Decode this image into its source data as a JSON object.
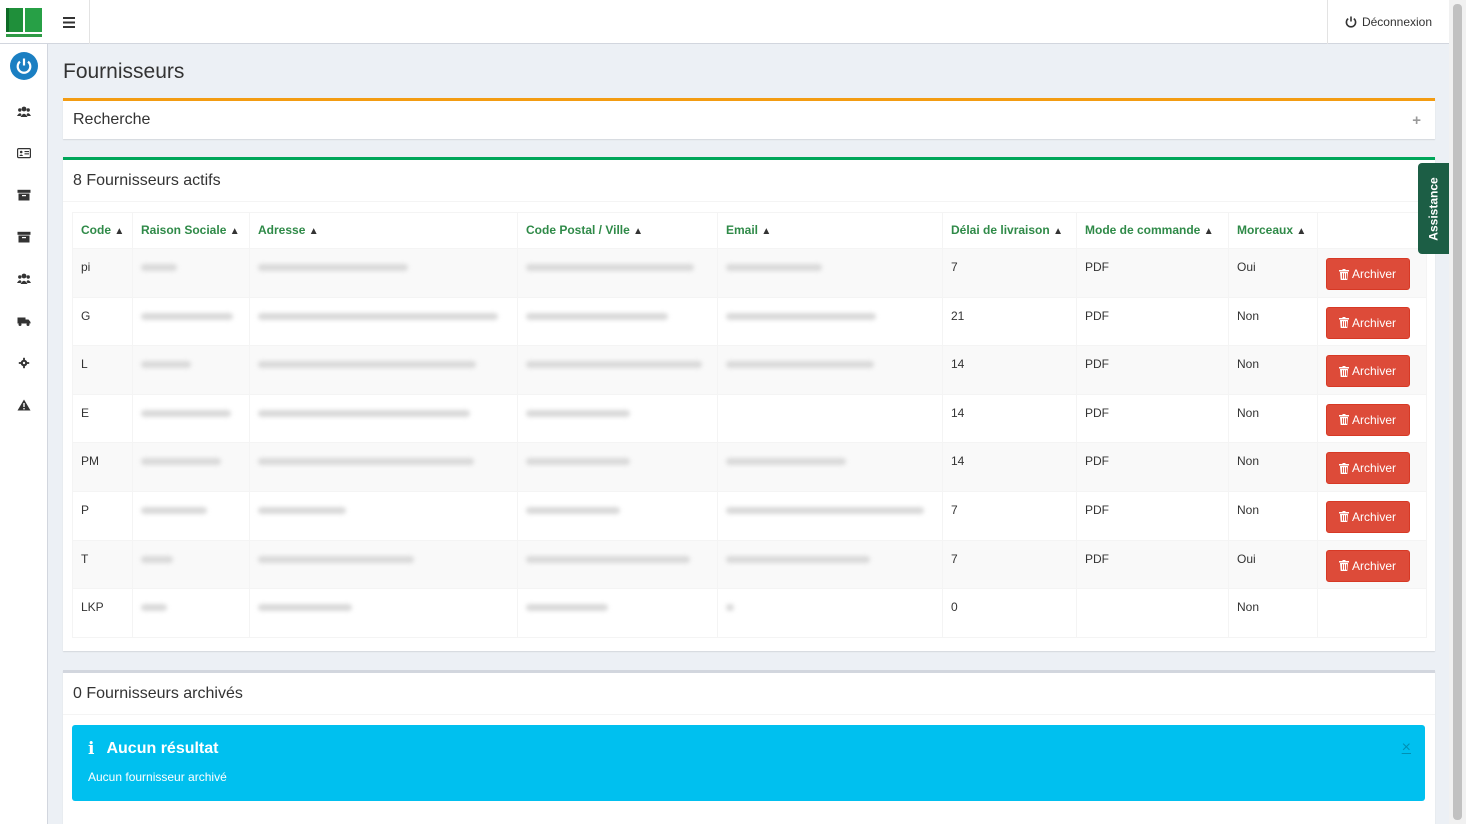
{
  "topbar": {
    "logout_label": "Déconnexion"
  },
  "sidebar": {
    "items": [
      "users-icon",
      "id-card-icon",
      "archive-box-icon",
      "archive-box-icon",
      "users-icon",
      "truck-icon",
      "gear-icon",
      "warning-icon"
    ]
  },
  "page": {
    "title": "Fournisseurs"
  },
  "search_box": {
    "title": "Recherche",
    "toggle": "+"
  },
  "active_box": {
    "title": "8 Fournisseurs actifs",
    "columns": [
      "Code",
      "Raison Sociale",
      "Adresse",
      "Code Postal / Ville",
      "Email",
      "Délai de livraison",
      "Mode de commande",
      "Morceaux"
    ],
    "archive_label": "Archiver",
    "rows": [
      {
        "code": "pi",
        "delai": "7",
        "mode": "PDF",
        "morceaux": "Oui",
        "archive": true
      },
      {
        "code": "G",
        "delai": "21",
        "mode": "PDF",
        "morceaux": "Non",
        "archive": true
      },
      {
        "code": "L",
        "delai": "14",
        "mode": "PDF",
        "morceaux": "Non",
        "archive": true
      },
      {
        "code": "E",
        "delai": "14",
        "mode": "PDF",
        "morceaux": "Non",
        "archive": true
      },
      {
        "code": "PM",
        "delai": "14",
        "mode": "PDF",
        "morceaux": "Non",
        "archive": true
      },
      {
        "code": "P",
        "delai": "7",
        "mode": "PDF",
        "morceaux": "Non",
        "archive": true
      },
      {
        "code": "T",
        "delai": "7",
        "mode": "PDF",
        "morceaux": "Oui",
        "archive": true
      },
      {
        "code": "LKP",
        "delai": "0",
        "mode": "",
        "morceaux": "Non",
        "archive": false
      }
    ]
  },
  "archived_box": {
    "title": "0 Fournisseurs archivés",
    "alert_title": "Aucun résultat",
    "alert_text": "Aucun fournisseur archivé",
    "alert_close": "×"
  },
  "assistance": {
    "label": "Assistance"
  },
  "colors": {
    "search_border": "#f39c12",
    "active_border": "#00a65a",
    "header_text": "#2f8a48",
    "archive_button": "#dd4b39",
    "info_alert": "#00c0ef",
    "assistance_tab": "#1c5e45"
  }
}
